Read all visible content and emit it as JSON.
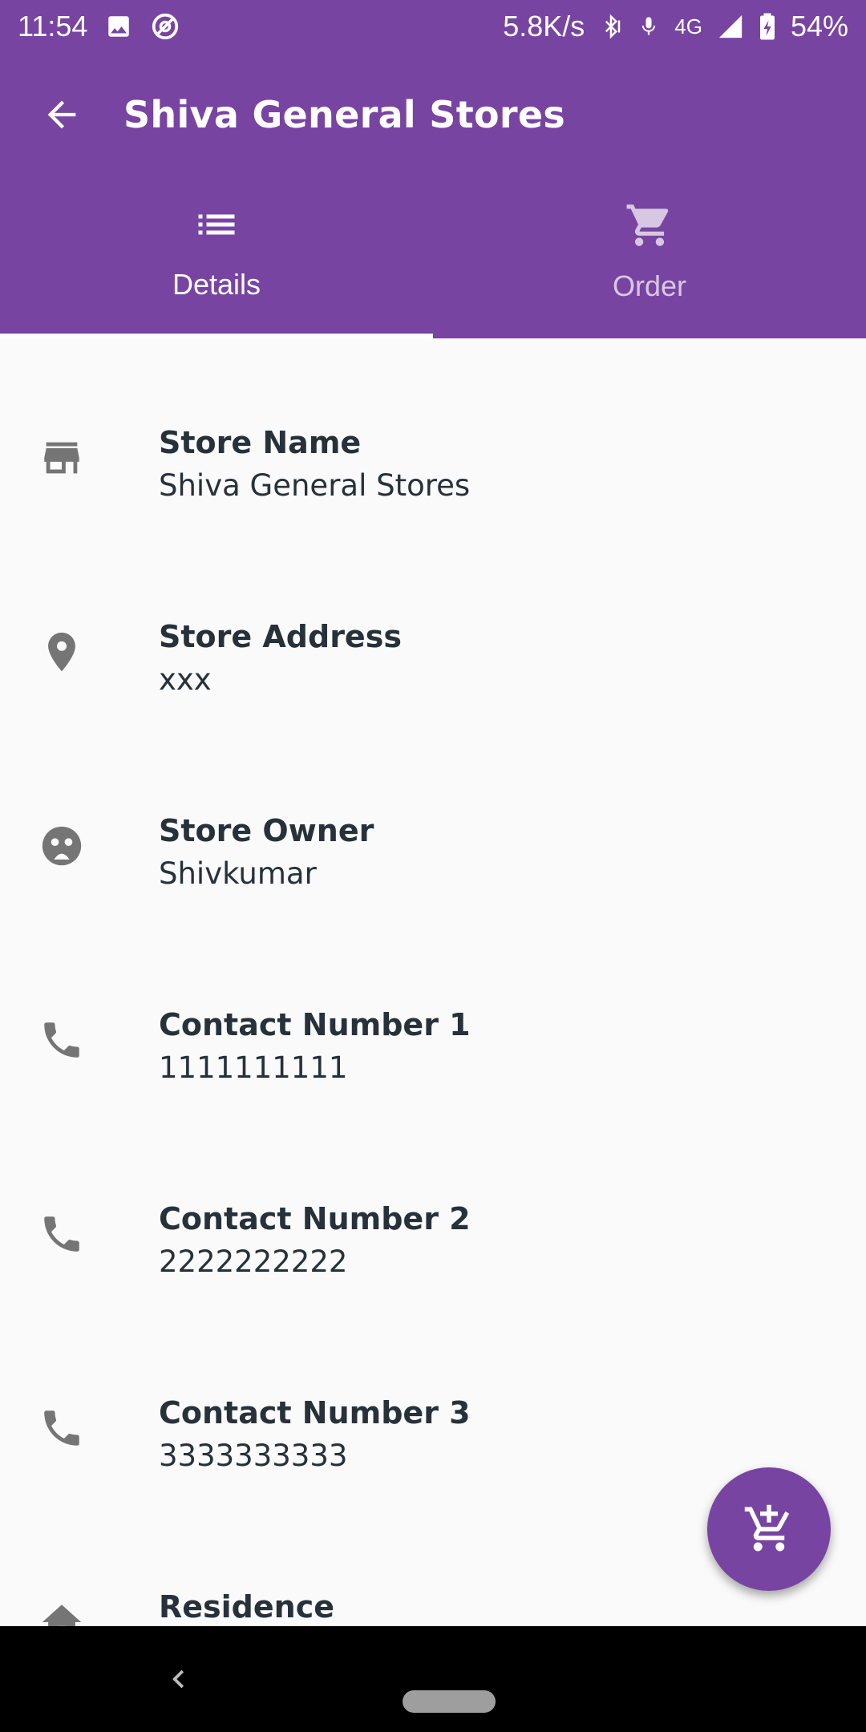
{
  "status_bar": {
    "time": "11:54",
    "net_speed": "5.8K/s",
    "network": "4G",
    "battery": "54%",
    "icons": [
      "image-icon",
      "sync-icon",
      "bluetooth-icon",
      "mic-icon",
      "signal-icon",
      "battery-icon"
    ]
  },
  "toolbar": {
    "title": "Shiva General Stores",
    "back_icon": "arrow-back-icon"
  },
  "tabs": [
    {
      "label": "Details",
      "icon": "list-icon",
      "selected": true
    },
    {
      "label": "Order",
      "icon": "cart-icon",
      "selected": false
    }
  ],
  "details": [
    {
      "label": "Store Name",
      "value": "Shiva General Stores",
      "icon": "store-icon"
    },
    {
      "label": "Store Address",
      "value": "xxx",
      "icon": "location-pin-icon"
    },
    {
      "label": "Store Owner",
      "value": "Shivkumar",
      "icon": "face-icon"
    },
    {
      "label": "Contact Number 1",
      "value": "1111111111",
      "icon": "phone-icon"
    },
    {
      "label": "Contact Number 2",
      "value": "2222222222",
      "icon": "phone-icon"
    },
    {
      "label": "Contact Number 3",
      "value": "3333333333",
      "icon": "phone-icon"
    },
    {
      "label": "Residence",
      "value": "",
      "icon": "home-icon"
    }
  ],
  "fab": {
    "icon": "add-shopping-cart-icon"
  },
  "colors": {
    "primary": "#7844a2",
    "text": "#27313a",
    "icon": "#757575",
    "background": "#fafafa"
  }
}
